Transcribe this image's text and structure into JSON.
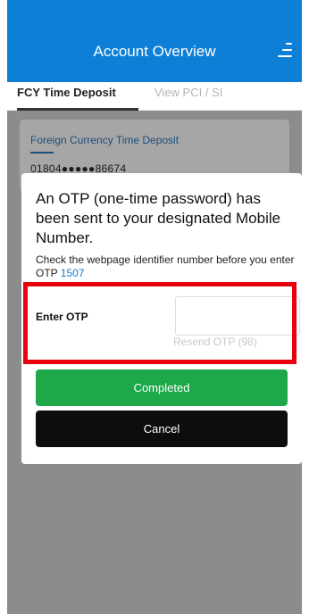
{
  "header": {
    "title": "Account Overview",
    "menu_icon": "hamburger-menu-icon",
    "color": "#0e7fd6"
  },
  "tabs": [
    {
      "label": "FCY Time Deposit",
      "active": true
    },
    {
      "label": "View PCI / SI",
      "active": false
    }
  ],
  "card": {
    "title": "Foreign Currency Time Deposit",
    "account_number": "01804●●●●●86674"
  },
  "otp_dialog": {
    "heading": "An OTP (one-time password) has been sent to your designated Mobile Number.",
    "note": "Check the webpage identifier number before you enter OTP",
    "identifier": "1507",
    "identifier_color": "#0e7fd6",
    "enter_label": "Enter OTP",
    "input_value": "",
    "input_placeholder": "",
    "resend_label": "Resend OTP (98)",
    "completed_label": "Completed",
    "completed_color": "#1ea84a",
    "cancel_label": "Cancel",
    "cancel_color": "#0d0d0d"
  },
  "highlight_color": "#e8000c"
}
